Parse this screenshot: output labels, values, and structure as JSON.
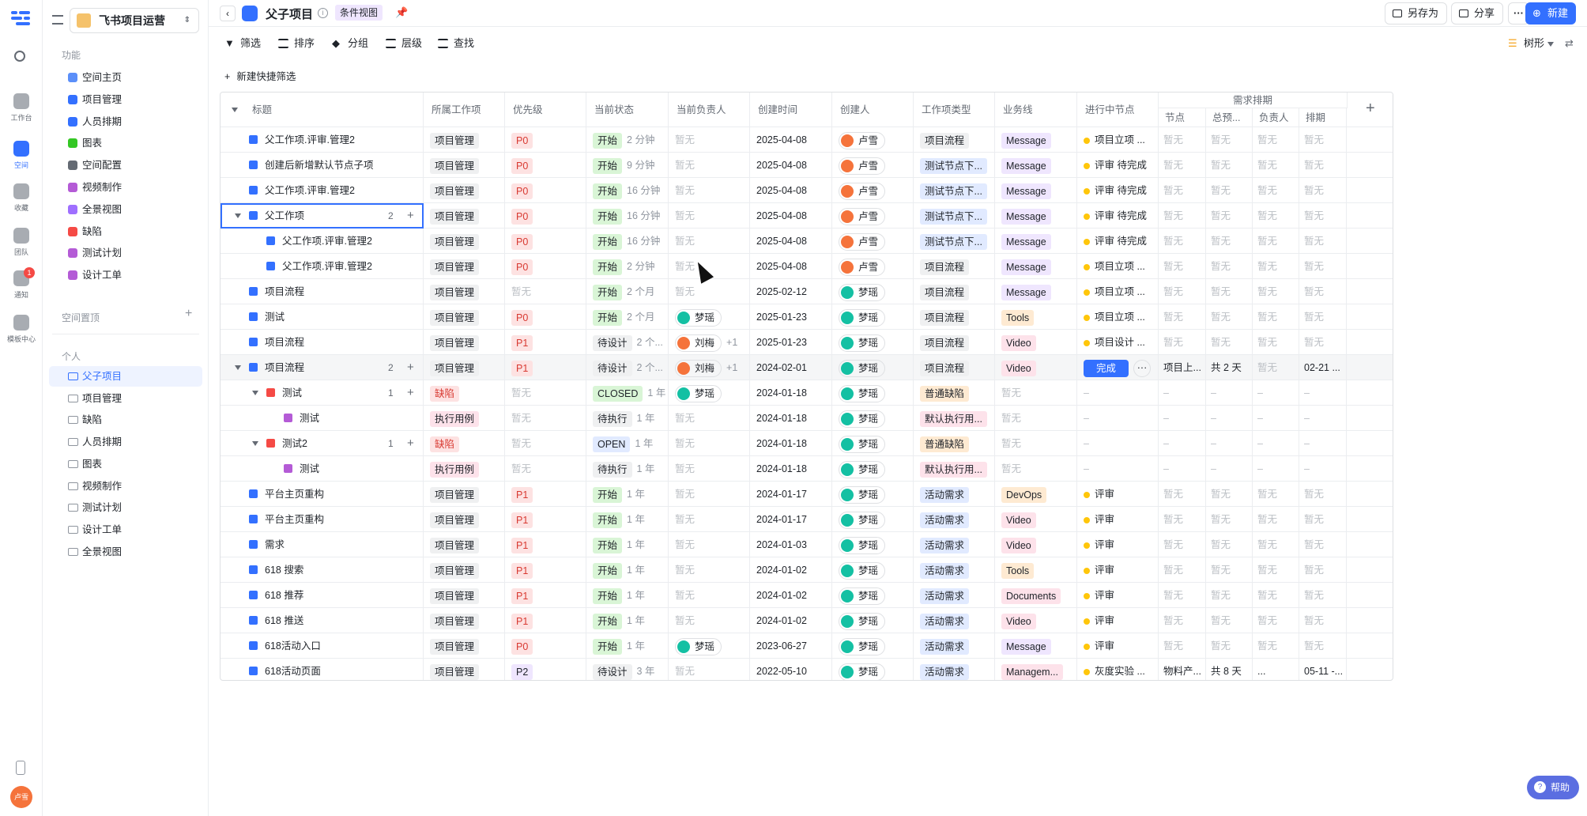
{
  "rail": {
    "items": [
      {
        "label": "工作台"
      },
      {
        "label": "空间"
      },
      {
        "label": "收藏"
      },
      {
        "label": "团队"
      },
      {
        "label": "通知",
        "badge": "1"
      },
      {
        "label": "模板中心"
      }
    ],
    "avatar_text": "卢雪"
  },
  "sidebar": {
    "workspace": "飞书项目运营",
    "section_function": "功能",
    "function_items": [
      {
        "label": "空间主页",
        "color": "#5b8ff9"
      },
      {
        "label": "项目管理",
        "color": "#3370ff"
      },
      {
        "label": "人员排期",
        "color": "#3370ff"
      },
      {
        "label": "图表",
        "color": "#34c724"
      },
      {
        "label": "空间配置",
        "color": "#646a73"
      },
      {
        "label": "视频制作",
        "color": "#b45bd6"
      },
      {
        "label": "全景视图",
        "color": "#9f6fff"
      },
      {
        "label": "缺陷",
        "color": "#f54a45"
      },
      {
        "label": "测试计划",
        "color": "#b45bd6"
      },
      {
        "label": "设计工单",
        "color": "#b45bd6"
      }
    ],
    "section_pinned": "空间置顶",
    "section_personal": "个人",
    "personal_items": [
      {
        "label": "父子项目",
        "selected": true
      },
      {
        "label": "项目管理"
      },
      {
        "label": "缺陷"
      },
      {
        "label": "人员排期"
      },
      {
        "label": "图表"
      },
      {
        "label": "视频制作"
      },
      {
        "label": "测试计划"
      },
      {
        "label": "设计工单"
      },
      {
        "label": "全景视图"
      }
    ]
  },
  "header": {
    "title": "父子项目",
    "view_tag": "条件视图",
    "save_as": "另存为",
    "share": "分享",
    "more": "···",
    "new": "新建"
  },
  "toolbar": {
    "filter": "筛选",
    "sort": "排序",
    "group": "分组",
    "level": "层级",
    "find": "查找",
    "view_mode": "树形",
    "quick_filter": "新建快捷筛选"
  },
  "table": {
    "columns": [
      "标题",
      "所属工作项",
      "优先级",
      "当前状态",
      "当前负责人",
      "创建时间",
      "创建人",
      "工作项类型",
      "业务线",
      "进行中节点"
    ],
    "group_header": "需求排期",
    "sub_columns": [
      "节点",
      "总预...",
      "负责人",
      "排期"
    ],
    "rows": [
      {
        "indent": 0,
        "color": "#3370ff",
        "title": "父工作项.评审.管理2",
        "item": "项目管理",
        "priority": "P0",
        "status": "开始",
        "age": "2 分钟",
        "owner": "暂无",
        "created": "2025-04-08",
        "creator": "卢雪",
        "type": "项目流程",
        "biz": "Message",
        "node": "项目立项 ...",
        "s1": "暂无",
        "s2": "暂无",
        "s3": "暂无",
        "s4": "暂无"
      },
      {
        "indent": 0,
        "color": "#3370ff",
        "title": "创建后新增默认节点子项",
        "item": "项目管理",
        "priority": "P0",
        "status": "开始",
        "age": "9 分钟",
        "owner": "暂无",
        "created": "2025-04-08",
        "creator": "卢雪",
        "type": "测试节点下...",
        "biz": "Message",
        "node": "评审 待完成",
        "s1": "暂无",
        "s2": "暂无",
        "s3": "暂无",
        "s4": "暂无"
      },
      {
        "indent": 0,
        "color": "#3370ff",
        "title": "父工作项.评审.管理2",
        "item": "项目管理",
        "priority": "P0",
        "status": "开始",
        "age": "16 分钟",
        "owner": "暂无",
        "created": "2025-04-08",
        "creator": "卢雪",
        "type": "测试节点下...",
        "biz": "Message",
        "node": "评审 待完成",
        "s1": "暂无",
        "s2": "暂无",
        "s3": "暂无",
        "s4": "暂无"
      },
      {
        "indent": 0,
        "expand": true,
        "color": "#3370ff",
        "title": "父工作项",
        "children": "2",
        "selected": true,
        "item": "项目管理",
        "priority": "P0",
        "status": "开始",
        "age": "16 分钟",
        "owner": "暂无",
        "created": "2025-04-08",
        "creator": "卢雪",
        "type": "测试节点下...",
        "biz": "Message",
        "node": "评审 待完成",
        "s1": "暂无",
        "s2": "暂无",
        "s3": "暂无",
        "s4": "暂无"
      },
      {
        "indent": 1,
        "color": "#3370ff",
        "title": "父工作项.评审.管理2",
        "item": "项目管理",
        "priority": "P0",
        "status": "开始",
        "age": "16 分钟",
        "owner": "暂无",
        "created": "2025-04-08",
        "creator": "卢雪",
        "type": "测试节点下...",
        "biz": "Message",
        "node": "评审 待完成",
        "s1": "暂无",
        "s2": "暂无",
        "s3": "暂无",
        "s4": "暂无"
      },
      {
        "indent": 1,
        "color": "#3370ff",
        "title": "父工作项.评审.管理2",
        "item": "项目管理",
        "priority": "P0",
        "status": "开始",
        "age": "2 分钟",
        "owner": "暂无",
        "created": "2025-04-08",
        "creator": "卢雪",
        "type": "项目流程",
        "biz": "Message",
        "node": "项目立项 ...",
        "s1": "暂无",
        "s2": "暂无",
        "s3": "暂无",
        "s4": "暂无"
      },
      {
        "indent": 0,
        "color": "#3370ff",
        "title": "项目流程",
        "item": "项目管理",
        "priority": "暂无",
        "status": "开始",
        "age": "2 个月",
        "owner": "暂无",
        "created": "2025-02-12",
        "creator": "梦瑶",
        "type": "项目流程",
        "biz": "Message",
        "node": "项目立项 ...",
        "s1": "暂无",
        "s2": "暂无",
        "s3": "暂无",
        "s4": "暂无"
      },
      {
        "indent": 0,
        "color": "#3370ff",
        "title": "测试",
        "item": "项目管理",
        "priority": "P0",
        "status": "开始",
        "age": "2 个月",
        "owner": "梦瑶",
        "created": "2025-01-23",
        "creator": "梦瑶",
        "type": "项目流程",
        "biz": "Tools",
        "node": "项目立项 ...",
        "s1": "暂无",
        "s2": "暂无",
        "s3": "暂无",
        "s4": "暂无"
      },
      {
        "indent": 0,
        "color": "#3370ff",
        "title": "项目流程",
        "item": "项目管理",
        "priority": "P1",
        "status": "待设计",
        "age": "2 个...",
        "owner": "刘梅",
        "owner_extra": "+1",
        "created": "2025-01-23",
        "creator": "梦瑶",
        "type": "项目流程",
        "biz": "Video",
        "node": "项目设计 ...",
        "s1": "暂无",
        "s2": "暂无",
        "s3": "暂无",
        "s4": "暂无"
      },
      {
        "indent": 0,
        "expand": true,
        "hover": true,
        "color": "#3370ff",
        "title": "项目流程",
        "children": "2",
        "item": "项目管理",
        "priority": "P1",
        "status": "待设计",
        "age": "2 个...",
        "owner": "刘梅",
        "owner_extra": "+1",
        "created": "2024-02-01",
        "creator": "梦瑶",
        "type": "项目流程",
        "biz": "Video",
        "node_button": "完成",
        "s1": "项目上...",
        "s2": "共 2 天",
        "s3": "暂无",
        "s4": "02-21 ..."
      },
      {
        "indent": 1,
        "expand": true,
        "color": "#f54a45",
        "title": "测试",
        "children": "1",
        "item": "缺陷",
        "priority": "暂无",
        "status": "CLOSED",
        "age": "1 年",
        "owner": "梦瑶",
        "created": "2024-01-18",
        "creator": "梦瑶",
        "type": "普通缺陷",
        "biz": "暂无",
        "node": "–",
        "s1": "–",
        "s2": "–",
        "s3": "–",
        "s4": "–"
      },
      {
        "indent": 2,
        "color": "#b45bd6",
        "title": "测试",
        "item": "执行用例",
        "priority": "暂无",
        "status": "待执行",
        "age": "1 年",
        "owner": "暂无",
        "created": "2024-01-18",
        "creator": "梦瑶",
        "type": "默认执行用...",
        "biz": "暂无",
        "node": "–",
        "s1": "–",
        "s2": "–",
        "s3": "–",
        "s4": "–"
      },
      {
        "indent": 1,
        "expand": true,
        "color": "#f54a45",
        "title": "测试2",
        "children": "1",
        "item": "缺陷",
        "priority": "暂无",
        "status": "OPEN",
        "age": "1 年",
        "owner": "暂无",
        "created": "2024-01-18",
        "creator": "梦瑶",
        "type": "普通缺陷",
        "biz": "暂无",
        "node": "–",
        "s1": "–",
        "s2": "–",
        "s3": "–",
        "s4": "–"
      },
      {
        "indent": 2,
        "color": "#b45bd6",
        "title": "测试",
        "item": "执行用例",
        "priority": "暂无",
        "status": "待执行",
        "age": "1 年",
        "owner": "暂无",
        "created": "2024-01-18",
        "creator": "梦瑶",
        "type": "默认执行用...",
        "biz": "暂无",
        "node": "–",
        "s1": "–",
        "s2": "–",
        "s3": "–",
        "s4": "–"
      },
      {
        "indent": 0,
        "color": "#3370ff",
        "title": "平台主页重构",
        "item": "项目管理",
        "priority": "P1",
        "status": "开始",
        "age": "1 年",
        "owner": "暂无",
        "created": "2024-01-17",
        "creator": "梦瑶",
        "type": "活动需求",
        "biz": "DevOps",
        "node": "评审",
        "s1": "暂无",
        "s2": "暂无",
        "s3": "暂无",
        "s4": "暂无"
      },
      {
        "indent": 0,
        "color": "#3370ff",
        "title": "平台主页重构",
        "item": "项目管理",
        "priority": "P1",
        "status": "开始",
        "age": "1 年",
        "owner": "暂无",
        "created": "2024-01-17",
        "creator": "梦瑶",
        "type": "活动需求",
        "biz": "Video",
        "node": "评审",
        "s1": "暂无",
        "s2": "暂无",
        "s3": "暂无",
        "s4": "暂无"
      },
      {
        "indent": 0,
        "color": "#3370ff",
        "title": "需求",
        "item": "项目管理",
        "priority": "P1",
        "status": "开始",
        "age": "1 年",
        "owner": "暂无",
        "created": "2024-01-03",
        "creator": "梦瑶",
        "type": "活动需求",
        "biz": "Video",
        "node": "评审",
        "s1": "暂无",
        "s2": "暂无",
        "s3": "暂无",
        "s4": "暂无"
      },
      {
        "indent": 0,
        "color": "#3370ff",
        "title": "618 搜索",
        "item": "项目管理",
        "priority": "P1",
        "status": "开始",
        "age": "1 年",
        "owner": "暂无",
        "created": "2024-01-02",
        "creator": "梦瑶",
        "type": "活动需求",
        "biz": "Tools",
        "node": "评审",
        "s1": "暂无",
        "s2": "暂无",
        "s3": "暂无",
        "s4": "暂无"
      },
      {
        "indent": 0,
        "color": "#3370ff",
        "title": "618 推荐",
        "item": "项目管理",
        "priority": "P1",
        "status": "开始",
        "age": "1 年",
        "owner": "暂无",
        "created": "2024-01-02",
        "creator": "梦瑶",
        "type": "活动需求",
        "biz": "Documents",
        "node": "评审",
        "s1": "暂无",
        "s2": "暂无",
        "s3": "暂无",
        "s4": "暂无"
      },
      {
        "indent": 0,
        "color": "#3370ff",
        "title": "618 推送",
        "item": "项目管理",
        "priority": "P1",
        "status": "开始",
        "age": "1 年",
        "owner": "暂无",
        "created": "2024-01-02",
        "creator": "梦瑶",
        "type": "活动需求",
        "biz": "Video",
        "node": "评审",
        "s1": "暂无",
        "s2": "暂无",
        "s3": "暂无",
        "s4": "暂无"
      },
      {
        "indent": 0,
        "color": "#3370ff",
        "title": "618活动入口",
        "item": "项目管理",
        "priority": "P0",
        "status": "开始",
        "age": "1 年",
        "owner": "梦瑶",
        "created": "2023-06-27",
        "creator": "梦瑶",
        "type": "活动需求",
        "biz": "Message",
        "node": "评审",
        "s1": "暂无",
        "s2": "暂无",
        "s3": "暂无",
        "s4": "暂无"
      },
      {
        "indent": 0,
        "color": "#3370ff",
        "title": "618活动页面",
        "item": "项目管理",
        "priority": "P2",
        "status": "待设计",
        "age": "3 年",
        "owner": "暂无",
        "created": "2022-05-10",
        "creator": "梦瑶",
        "type": "活动需求",
        "biz": "Managem...",
        "node": "灰度实验 ...",
        "s1": "物料产...",
        "s2": "共 8 天",
        "s3": "...",
        "s4": "05-11 -..."
      }
    ]
  },
  "help": "帮助"
}
